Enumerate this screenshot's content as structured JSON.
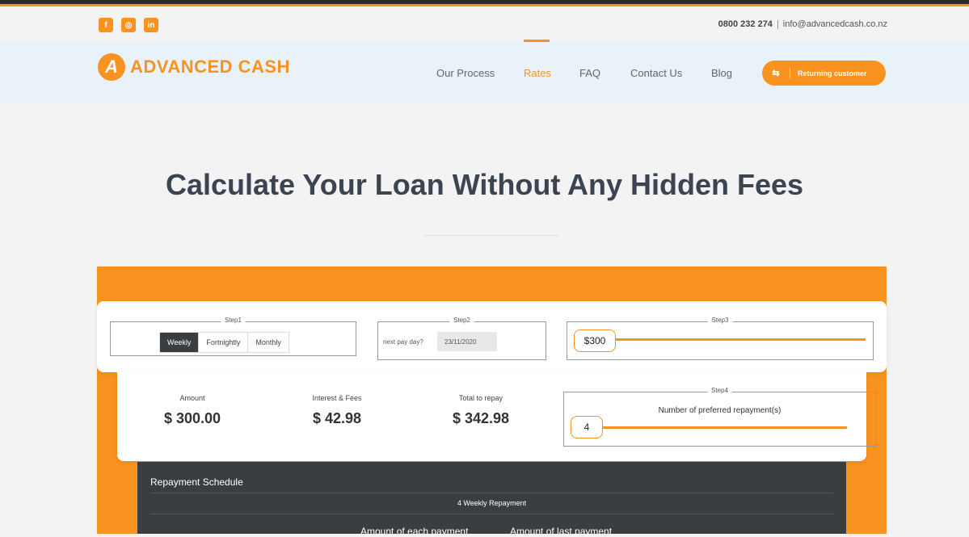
{
  "header": {
    "social": [
      "f",
      "◎",
      "in"
    ],
    "phone": "0800 232 274",
    "separator": "|",
    "email": "info@advancedcash.co.nz"
  },
  "nav": {
    "logo_text": "ADVANCED CASH",
    "logo_letter": "A",
    "items": [
      "Our Process",
      "Rates",
      "FAQ",
      "Contact Us",
      "Blog"
    ],
    "active": "Rates",
    "returning_icon": "⇆",
    "returning_label": "Returning customer"
  },
  "hero": {
    "title": "Calculate Your Loan Without Any Hidden Fees"
  },
  "calculator": {
    "step1": {
      "legend": "Step1",
      "options": [
        "Weekly",
        "Fortnightly",
        "Monthly"
      ],
      "selected": "Weekly"
    },
    "step2": {
      "legend": "Step2",
      "label": "next pay day?",
      "value": "23/11/2020"
    },
    "step3": {
      "legend": "Step3",
      "amount": "$300"
    },
    "step4": {
      "legend": "Step4",
      "title": "Number of preferred repayment(s)",
      "value": "4"
    },
    "summary": {
      "amount_label": "Amount",
      "amount": "$ 300.00",
      "fees_label": "Interest & Fees",
      "fees": "$ 42.98",
      "total_label": "Total to repay",
      "total": "$ 342.98"
    }
  },
  "schedule": {
    "title": "Repayment Schedule",
    "subtitle": "4 Weekly Repayment",
    "col1": "Amount of each payment",
    "col2": "Amount of last payment"
  },
  "colors": {
    "accent": "#f7931e",
    "dark": "#3b3e40",
    "nav_bg": "#e9f1f9"
  }
}
